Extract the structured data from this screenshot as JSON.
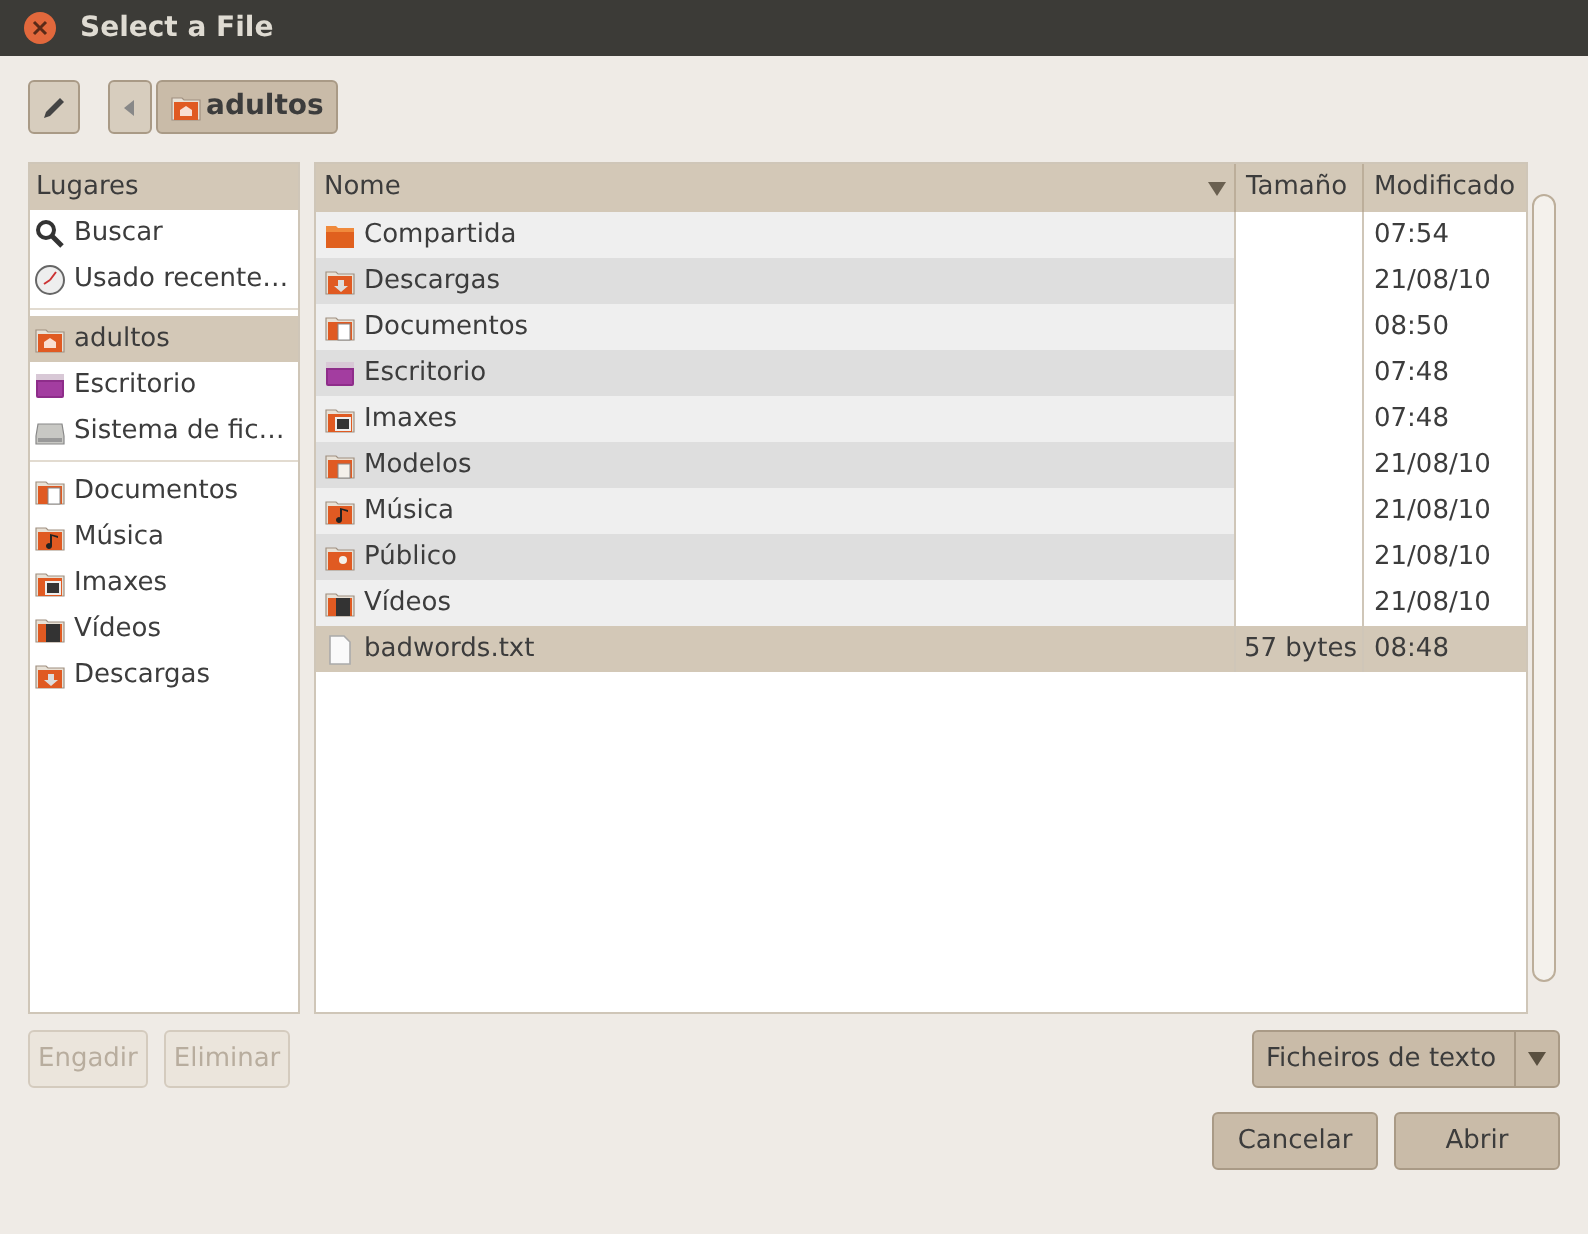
{
  "window": {
    "title": "Select a File"
  },
  "path_bar": {
    "segments": [
      {
        "label": "adultos",
        "kind": "home"
      }
    ]
  },
  "sidebar": {
    "title": "Lugares",
    "groups": [
      [
        {
          "label": "Buscar",
          "kind": "search",
          "selected": false
        },
        {
          "label": "Usado recente…",
          "kind": "recent",
          "selected": false
        }
      ],
      [
        {
          "label": "adultos",
          "kind": "home",
          "selected": true
        },
        {
          "label": "Escritorio",
          "kind": "desktop",
          "selected": false
        },
        {
          "label": "Sistema de fic…",
          "kind": "drive",
          "selected": false
        }
      ],
      [
        {
          "label": "Documentos",
          "kind": "documents",
          "selected": false
        },
        {
          "label": "Música",
          "kind": "music",
          "selected": false
        },
        {
          "label": "Imaxes",
          "kind": "pictures",
          "selected": false
        },
        {
          "label": "Vídeos",
          "kind": "videos",
          "selected": false
        },
        {
          "label": "Descargas",
          "kind": "downloads",
          "selected": false
        }
      ]
    ]
  },
  "table": {
    "columns": [
      "Nome",
      "Tamaño",
      "Modificado"
    ],
    "rows": [
      {
        "name": "Compartida",
        "kind": "folder",
        "modified": "07:54",
        "selected": false
      },
      {
        "name": "Descargas",
        "kind": "downloads",
        "modified": "21/08/10",
        "selected": false
      },
      {
        "name": "Documentos",
        "kind": "documents",
        "modified": "08:50",
        "selected": false
      },
      {
        "name": "Escritorio",
        "kind": "desktop",
        "modified": "07:48",
        "selected": false
      },
      {
        "name": "Imaxes",
        "kind": "pictures",
        "modified": "07:48",
        "selected": false
      },
      {
        "name": "Modelos",
        "kind": "templates",
        "modified": "21/08/10",
        "selected": false
      },
      {
        "name": "Música",
        "kind": "music",
        "modified": "21/08/10",
        "selected": false
      },
      {
        "name": "Público",
        "kind": "public",
        "modified": "21/08/10",
        "selected": false
      },
      {
        "name": "Vídeos",
        "kind": "videos",
        "modified": "21/08/10",
        "selected": false
      },
      {
        "name": "badwords.txt",
        "kind": "file",
        "size": "57 bytes",
        "modified": "08:48",
        "selected": true
      }
    ]
  },
  "sidebar_buttons": [
    {
      "label": "Engadir",
      "disabled": true
    },
    {
      "label": "Eliminar",
      "disabled": true
    }
  ],
  "filter": {
    "value": "Ficheiros de texto"
  },
  "buttons": [
    "Cancelar",
    "Abrir"
  ]
}
